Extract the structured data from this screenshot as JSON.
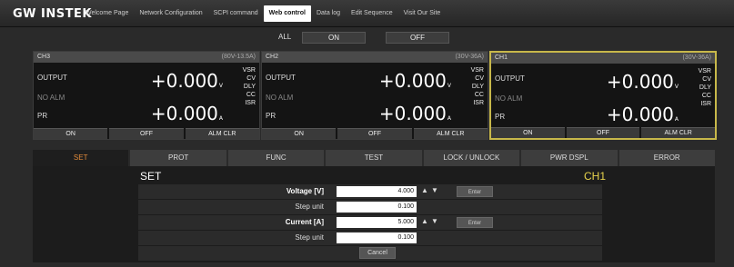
{
  "brand": {
    "logo": "GW INSTEK"
  },
  "nav": [
    "Welcome Page",
    "Network Configuration",
    "SCPI command",
    "Web control",
    "Data log",
    "Edit Sequence",
    "Visit Our Site"
  ],
  "all": {
    "label": "ALL",
    "on": "ON",
    "off": "OFF"
  },
  "channels": [
    {
      "name": "CH3",
      "spec": "(80V-13.5A)",
      "output_label": "OUTPUT",
      "alarm": "NO ALM",
      "pr": "PR",
      "voltage": "+0.000",
      "vunit": "V",
      "current": "+0.000",
      "cunit": "A",
      "status": [
        "VSR",
        "CV",
        "DLY",
        "CC",
        "ISR"
      ],
      "btn_on": "ON",
      "btn_off": "OFF",
      "btn_clr": "ALM CLR"
    },
    {
      "name": "CH2",
      "spec": "(30V-36A)",
      "output_label": "OUTPUT",
      "alarm": "NO ALM",
      "pr": "PR",
      "voltage": "+0.000",
      "vunit": "V",
      "current": "+0.000",
      "cunit": "A",
      "status": [
        "VSR",
        "CV",
        "DLY",
        "CC",
        "ISR"
      ],
      "btn_on": "ON",
      "btn_off": "OFF",
      "btn_clr": "ALM CLR"
    },
    {
      "name": "CH1",
      "spec": "(30V-36A)",
      "output_label": "OUTPUT",
      "alarm": "NO ALM",
      "pr": "PR",
      "voltage": "+0.000",
      "vunit": "V",
      "current": "+0.000",
      "cunit": "A",
      "status": [
        "VSR",
        "CV",
        "DLY",
        "CC",
        "ISR"
      ],
      "btn_on": "ON",
      "btn_off": "OFF",
      "btn_clr": "ALM CLR"
    }
  ],
  "tabs": [
    "SET",
    "PROT",
    "FUNC",
    "TEST",
    "LOCK / UNLOCK",
    "PWR DSPL",
    "ERROR"
  ],
  "panel": {
    "title": "SET",
    "channel": "CH1",
    "voltage_label": "Voltage [V]",
    "voltage_value": "4.000",
    "vstep_label": "Step unit",
    "vstep_value": "0.100",
    "current_label": "Current [A]",
    "current_value": "5.000",
    "cstep_label": "Step unit",
    "cstep_value": "0.100",
    "enter": "Enter",
    "cancel": "Cancel"
  },
  "colors": {
    "accent": "#e08a3a",
    "selected_border": "#c8b84a",
    "channel_title": "#e7d34c"
  }
}
